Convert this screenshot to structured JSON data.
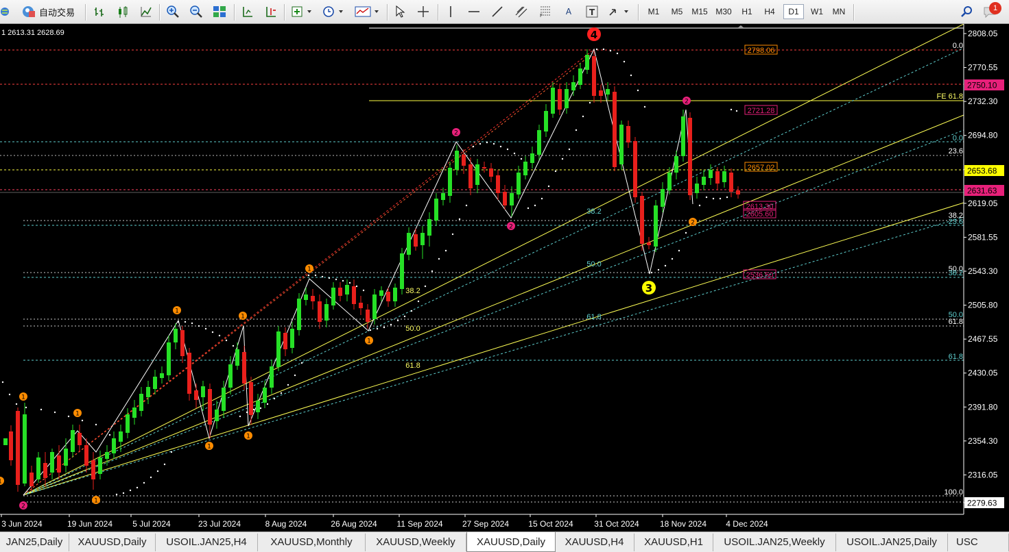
{
  "toolbar": {
    "autotrade_label": "自动交易",
    "timeframes": [
      "M1",
      "M5",
      "M15",
      "M30",
      "H1",
      "H4",
      "D1",
      "W1",
      "MN"
    ],
    "active_timeframe": "D1",
    "notification_count": "1",
    "text_tool_label": "A"
  },
  "chart_info": {
    "ohlc_text": "1 2613.31 2628.69"
  },
  "price_axis": {
    "ticks": [
      "2808.05",
      "2770.55",
      "2732.30",
      "2694.80",
      "2656.55",
      "2619.05",
      "2581.55",
      "2543.30",
      "2505.80",
      "2467.55",
      "2430.05",
      "2391.80",
      "2354.30",
      "2316.05",
      "2279.63"
    ],
    "badges": [
      {
        "label": "2750.10",
        "color": "#e8207a"
      },
      {
        "label": "2653.68",
        "color": "#ffff00"
      },
      {
        "label": "2631.63",
        "color": "#e8207a"
      },
      {
        "label": "2279.63",
        "color": "#ffffff"
      }
    ]
  },
  "time_axis": {
    "labels": [
      "3 Jun 2024",
      "19 Jun 2024",
      "5 Jul 2024",
      "23 Jul 2024",
      "8 Aug 2024",
      "26 Aug 2024",
      "11 Sep 2024",
      "27 Sep 2024",
      "15 Oct 2024",
      "31 Oct 2024",
      "18 Nov 2024",
      "4 Dec 2024"
    ]
  },
  "price_labels": [
    {
      "text": "2798.06",
      "color": "#ff8c00"
    },
    {
      "text": "2721.28",
      "color": "#e8207a"
    },
    {
      "text": "2657.02",
      "color": "#ff8c00"
    },
    {
      "text": "2613.30",
      "color": "#e8207a"
    },
    {
      "text": "2605.60",
      "color": "#e8207a"
    },
    {
      "text": "2536.50",
      "color": "#e8207a"
    }
  ],
  "fib_labels": {
    "fe_618": "FE 61.8",
    "right_levels": [
      "0.0",
      "0.0",
      "23.6",
      "38.2",
      "23.6",
      "50.0",
      "38.2",
      "50.0",
      "61.8",
      "61.8",
      "100.0"
    ],
    "mid_levels": [
      "38.2",
      "50.0",
      "61.8"
    ],
    "left_levels": [
      "38.2",
      "50.0",
      "61.8"
    ]
  },
  "wave_markers": {
    "big_4": "4",
    "big_3": "3",
    "small_labels": [
      "1",
      "2"
    ]
  },
  "colors": {
    "bull": "#26e026",
    "bear": "#e8201c",
    "fib_yellow": "#ffff66",
    "fib_cyan": "#5fd0d0",
    "magenta": "#e8207a",
    "orange": "#ff8c00"
  },
  "tabs": [
    "JAN25,Daily",
    "XAUUSD,Daily",
    "USOIL.JAN25,H4",
    "XAUUSD,Monthly",
    "XAUUSD,Weekly",
    "XAUUSD,Daily",
    "XAUUSD,H4",
    "XAUUSD,H1",
    "USOIL.JAN25,Weekly",
    "USOIL.JAN25,Daily",
    "USC"
  ],
  "active_tab_index": 5
}
